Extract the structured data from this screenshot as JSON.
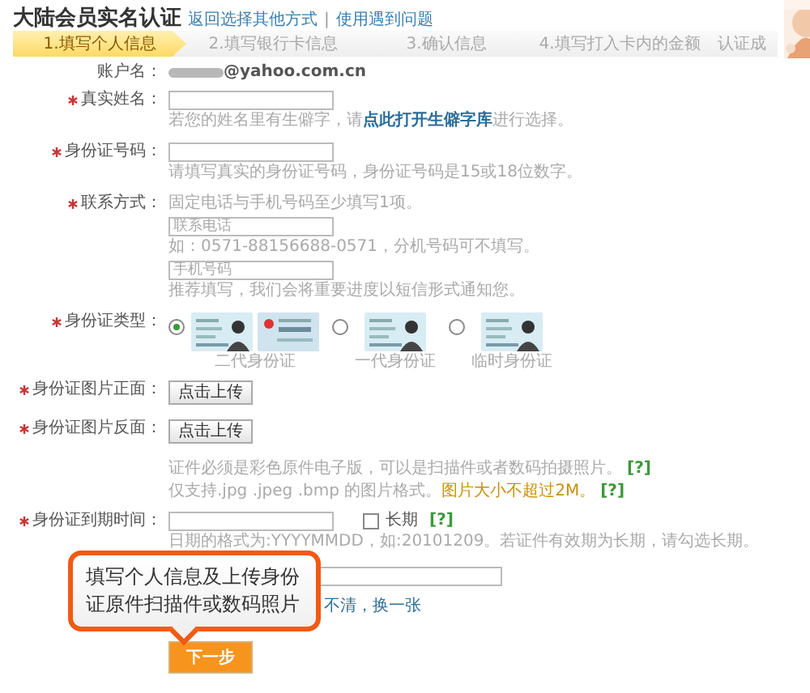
{
  "header": {
    "title": "大陆会员实名认证",
    "links": [
      "返回选择其他方式",
      "使用遇到问题"
    ],
    "separator": "|"
  },
  "steps": [
    {
      "label": "1.填写个人信息",
      "selected": true
    },
    {
      "label": "2.填写银行卡信息",
      "selected": false
    },
    {
      "label": "3.确认信息",
      "selected": false
    },
    {
      "label": "4.填写打入卡内的金额",
      "selected": false
    },
    {
      "label": "认证成",
      "selected": false
    }
  ],
  "rows": [
    {
      "kind": "account",
      "label": "账户名：",
      "value": "@yahoo.com.cn"
    },
    {
      "kind": "input",
      "required": true,
      "label": "真实姓名：",
      "hint": "若您的姓名里有生僻字，请",
      "hint_link": "点此打开生僻字库",
      "hint_after": "进行选择。"
    },
    {
      "kind": "input",
      "required": true,
      "label": "身份证号码：",
      "hint": "请填写真实的身份证号码，身份证号码是15或18位数字。"
    },
    {
      "kind": "contact",
      "required": true,
      "label": "联系方式：",
      "note": "固定电话与手机号码至少填写1项。",
      "inputs": [
        {
          "placeholder": "联系电话",
          "hint": "如：0571-88156688-0571，分机号码可不填写。"
        },
        {
          "placeholder": "手机号码",
          "hint": "推荐填写，我们会将重要进度以短信形式通知您。"
        }
      ]
    },
    {
      "kind": "radio",
      "required": true,
      "label": "身份证类型：",
      "options": [
        {
          "label": "二代身份证",
          "selected": true
        },
        {
          "label": "一代身份证",
          "selected": false
        },
        {
          "label": "临时身份证",
          "selected": false
        }
      ]
    },
    {
      "kind": "upload",
      "required": true,
      "label": "身份证图片正面：",
      "button": "点击上传"
    },
    {
      "kind": "upload",
      "required": true,
      "label": "身份证图片反面：",
      "button": "点击上传"
    },
    {
      "kind": "notes",
      "lines": [
        {
          "text": "证件必须是彩色原件电子版，可以是扫描件或者数码拍摄照片。",
          "help": "[?]"
        },
        {
          "text": "仅支持.jpg .jpeg .bmp 的图片格式。",
          "highlight": "图片大小不超过2M。",
          "help": "[?]"
        }
      ]
    },
    {
      "kind": "date",
      "required": true,
      "label": "身份证到期时间：",
      "checkbox": {
        "label": "长期",
        "checked": false,
        "help": "[?]"
      },
      "hint": "日期的格式为:YYYYMMDD，如:20101209。若证件有效期为长期，请勾选长期。"
    },
    {
      "kind": "captcha",
      "link": "不清，换一张"
    }
  ],
  "tooltip": "填写个人信息及上传身份证原件扫描件或数码照片",
  "submit": "下一步"
}
